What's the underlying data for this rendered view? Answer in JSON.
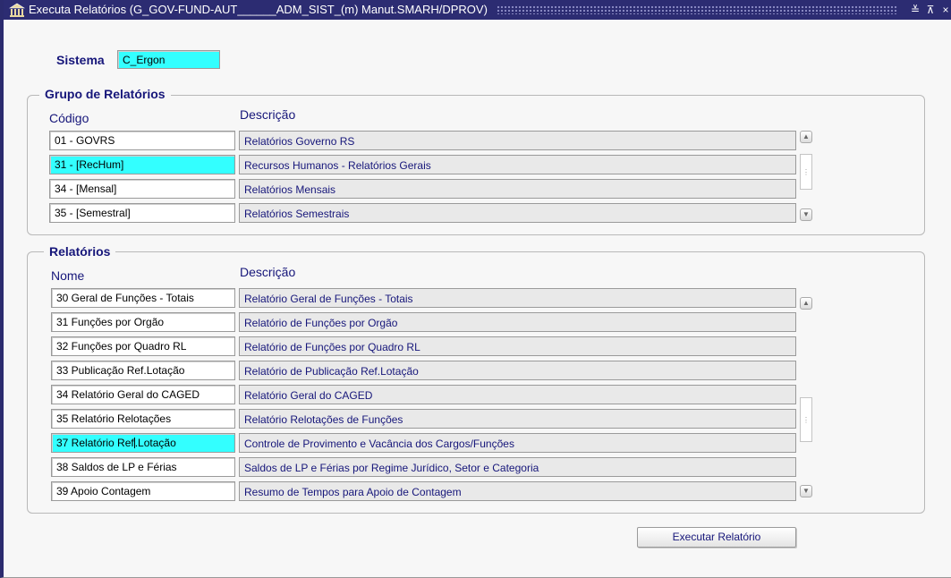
{
  "window": {
    "title": "Executa Relatórios (G_GOV-FUND-AUT______ADM_SIST_(m) Manut.SMARH/DPROV)",
    "minimize_glyph": "≚",
    "maximize_glyph": "⊼",
    "close_glyph": "×"
  },
  "sistema": {
    "label": "Sistema",
    "value": "C_Ergon"
  },
  "grupo": {
    "title": "Grupo de Relatórios",
    "col_codigo": "Código",
    "col_descricao": "Descrição",
    "rows": [
      {
        "codigo": "01 - GOVRS",
        "descricao": "Relatórios Governo RS",
        "selected": false
      },
      {
        "codigo": "31 - [RecHum]",
        "descricao": "Recursos Humanos - Relatórios Gerais",
        "selected": true
      },
      {
        "codigo": "34 - [Mensal]",
        "descricao": "Relatórios Mensais",
        "selected": false
      },
      {
        "codigo": "35 - [Semestral]",
        "descricao": "Relatórios Semestrais",
        "selected": false
      }
    ]
  },
  "relatorios": {
    "title": "Relatórios",
    "col_nome": "Nome",
    "col_descricao": "Descrição",
    "rows": [
      {
        "nome": "30 Geral de Funções - Totais",
        "descricao": "Relatório Geral de Funções - Totais",
        "selected": false
      },
      {
        "nome": "31 Funções por Orgão",
        "descricao": "Relatório de Funções por Orgão",
        "selected": false
      },
      {
        "nome": "32 Funções por Quadro RL",
        "descricao": "Relatório de Funções por Quadro RL",
        "selected": false
      },
      {
        "nome": "33 Publicação Ref.Lotação",
        "descricao": "Relatório de Publicação Ref.Lotação",
        "selected": false
      },
      {
        "nome": "34 Relatório Geral do CAGED",
        "descricao": "Relatório Geral do CAGED",
        "selected": false
      },
      {
        "nome": "35 Relatório Relotações",
        "descricao": "Relatório Relotações de Funções",
        "selected": false
      },
      {
        "nome_before_cursor": "37 Relatório Ref",
        "nome_after_cursor": ".Lotação",
        "descricao": "Controle de Provimento e Vacância dos Cargos/Funções",
        "selected": true
      },
      {
        "nome": "38 Saldos de LP e Férias",
        "descricao": "Saldos de LP e Férias por Regime Jurídico, Setor e Categoria",
        "selected": false
      },
      {
        "nome": "39 Apoio Contagem",
        "descricao": "Resumo de Tempos para Apoio de Contagem",
        "selected": false
      }
    ]
  },
  "actions": {
    "execute_label": "Executar Relatório"
  },
  "colors": {
    "titlebar": "#2c2c72",
    "label_text": "#16167a",
    "selected_field": "#33ffff",
    "readonly_field": "#e9e9e9"
  }
}
